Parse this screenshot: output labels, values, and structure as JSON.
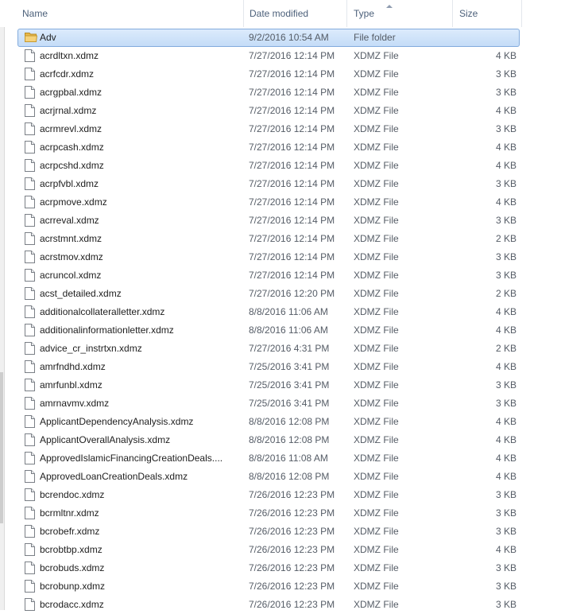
{
  "columns": {
    "name": "Name",
    "date_modified": "Date modified",
    "type": "Type",
    "size": "Size"
  },
  "icons": {
    "folder": "folder-icon",
    "file": "file-icon"
  },
  "files": [
    {
      "name": "Adv",
      "date": "9/2/2016 10:54 AM",
      "type": "File folder",
      "size": "",
      "kind": "folder",
      "selected": true
    },
    {
      "name": "acrdltxn.xdmz",
      "date": "7/27/2016 12:14 PM",
      "type": "XDMZ File",
      "size": "4 KB",
      "kind": "file"
    },
    {
      "name": "acrfcdr.xdmz",
      "date": "7/27/2016 12:14 PM",
      "type": "XDMZ File",
      "size": "3 KB",
      "kind": "file"
    },
    {
      "name": "acrgpbal.xdmz",
      "date": "7/27/2016 12:14 PM",
      "type": "XDMZ File",
      "size": "3 KB",
      "kind": "file"
    },
    {
      "name": "acrjrnal.xdmz",
      "date": "7/27/2016 12:14 PM",
      "type": "XDMZ File",
      "size": "4 KB",
      "kind": "file"
    },
    {
      "name": "acrmrevl.xdmz",
      "date": "7/27/2016 12:14 PM",
      "type": "XDMZ File",
      "size": "3 KB",
      "kind": "file"
    },
    {
      "name": "acrpcash.xdmz",
      "date": "7/27/2016 12:14 PM",
      "type": "XDMZ File",
      "size": "4 KB",
      "kind": "file"
    },
    {
      "name": "acrpcshd.xdmz",
      "date": "7/27/2016 12:14 PM",
      "type": "XDMZ File",
      "size": "4 KB",
      "kind": "file"
    },
    {
      "name": "acrpfvbl.xdmz",
      "date": "7/27/2016 12:14 PM",
      "type": "XDMZ File",
      "size": "3 KB",
      "kind": "file"
    },
    {
      "name": "acrpmove.xdmz",
      "date": "7/27/2016 12:14 PM",
      "type": "XDMZ File",
      "size": "4 KB",
      "kind": "file"
    },
    {
      "name": "acrreval.xdmz",
      "date": "7/27/2016 12:14 PM",
      "type": "XDMZ File",
      "size": "3 KB",
      "kind": "file"
    },
    {
      "name": "acrstmnt.xdmz",
      "date": "7/27/2016 12:14 PM",
      "type": "XDMZ File",
      "size": "2 KB",
      "kind": "file"
    },
    {
      "name": "acrstmov.xdmz",
      "date": "7/27/2016 12:14 PM",
      "type": "XDMZ File",
      "size": "3 KB",
      "kind": "file"
    },
    {
      "name": "acruncol.xdmz",
      "date": "7/27/2016 12:14 PM",
      "type": "XDMZ File",
      "size": "3 KB",
      "kind": "file"
    },
    {
      "name": "acst_detailed.xdmz",
      "date": "7/27/2016 12:20 PM",
      "type": "XDMZ File",
      "size": "2 KB",
      "kind": "file"
    },
    {
      "name": "additionalcollateralletter.xdmz",
      "date": "8/8/2016 11:06 AM",
      "type": "XDMZ File",
      "size": "4 KB",
      "kind": "file"
    },
    {
      "name": "additionalinformationletter.xdmz",
      "date": "8/8/2016 11:06 AM",
      "type": "XDMZ File",
      "size": "4 KB",
      "kind": "file"
    },
    {
      "name": "advice_cr_instrtxn.xdmz",
      "date": "7/27/2016 4:31 PM",
      "type": "XDMZ File",
      "size": "2 KB",
      "kind": "file"
    },
    {
      "name": "amrfndhd.xdmz",
      "date": "7/25/2016 3:41 PM",
      "type": "XDMZ File",
      "size": "4 KB",
      "kind": "file"
    },
    {
      "name": "amrfunbl.xdmz",
      "date": "7/25/2016 3:41 PM",
      "type": "XDMZ File",
      "size": "3 KB",
      "kind": "file"
    },
    {
      "name": "amrnavmv.xdmz",
      "date": "7/25/2016 3:41 PM",
      "type": "XDMZ File",
      "size": "3 KB",
      "kind": "file"
    },
    {
      "name": "ApplicantDependencyAnalysis.xdmz",
      "date": "8/8/2016 12:08 PM",
      "type": "XDMZ File",
      "size": "4 KB",
      "kind": "file"
    },
    {
      "name": "ApplicantOverallAnalysis.xdmz",
      "date": "8/8/2016 12:08 PM",
      "type": "XDMZ File",
      "size": "4 KB",
      "kind": "file"
    },
    {
      "name": "ApprovedIslamicFinancingCreationDeals....",
      "date": "8/8/2016 11:08 AM",
      "type": "XDMZ File",
      "size": "4 KB",
      "kind": "file"
    },
    {
      "name": "ApprovedLoanCreationDeals.xdmz",
      "date": "8/8/2016 12:08 PM",
      "type": "XDMZ File",
      "size": "4 KB",
      "kind": "file"
    },
    {
      "name": "bcrendoc.xdmz",
      "date": "7/26/2016 12:23 PM",
      "type": "XDMZ File",
      "size": "3 KB",
      "kind": "file"
    },
    {
      "name": "bcrmltnr.xdmz",
      "date": "7/26/2016 12:23 PM",
      "type": "XDMZ File",
      "size": "3 KB",
      "kind": "file"
    },
    {
      "name": "bcrobefr.xdmz",
      "date": "7/26/2016 12:23 PM",
      "type": "XDMZ File",
      "size": "3 KB",
      "kind": "file"
    },
    {
      "name": "bcrobtbp.xdmz",
      "date": "7/26/2016 12:23 PM",
      "type": "XDMZ File",
      "size": "4 KB",
      "kind": "file"
    },
    {
      "name": "bcrobuds.xdmz",
      "date": "7/26/2016 12:23 PM",
      "type": "XDMZ File",
      "size": "3 KB",
      "kind": "file"
    },
    {
      "name": "bcrobunp.xdmz",
      "date": "7/26/2016 12:23 PM",
      "type": "XDMZ File",
      "size": "3 KB",
      "kind": "file"
    },
    {
      "name": "bcrodacc.xdmz",
      "date": "7/26/2016 12:23 PM",
      "type": "XDMZ File",
      "size": "3 KB",
      "kind": "file"
    }
  ]
}
